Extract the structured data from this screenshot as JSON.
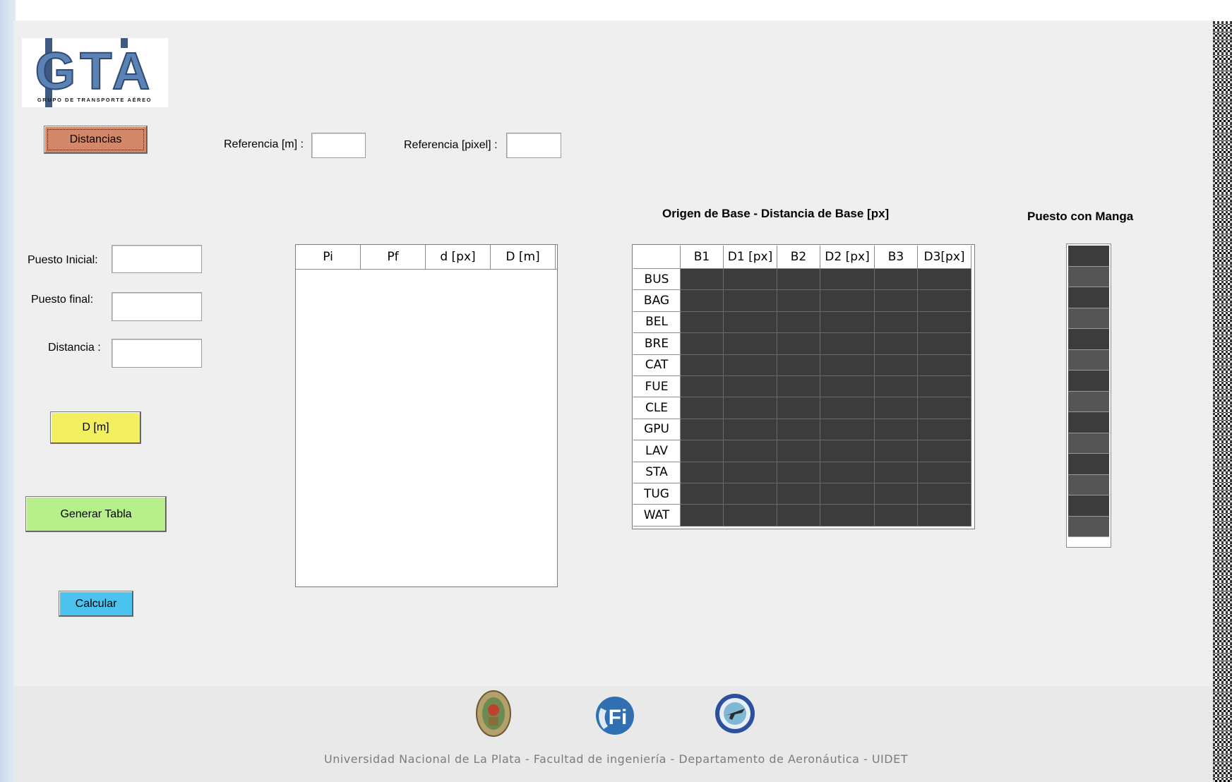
{
  "logo": {
    "text": "GTA",
    "subtitle": "GRUPO DE TRANSPORTE AÉREO"
  },
  "toolbar": {
    "distancias_label": "Distancias",
    "ref_m_label": "Referencia [m] :",
    "ref_m_value": "",
    "ref_px_label": "Referencia [pixel] :",
    "ref_px_value": ""
  },
  "form": {
    "puesto_inicial_label": "Puesto Inicial:",
    "puesto_inicial_value": "",
    "puesto_final_label": "Puesto final:",
    "puesto_final_value": "",
    "distancia_label": "Distancia :",
    "distancia_value": ""
  },
  "buttons": {
    "dm_label": "D [m]",
    "generar_label": "Generar Tabla",
    "calcular_label": "Calcular"
  },
  "distance_table": {
    "columns": [
      "Pi",
      "Pf",
      "d [px]",
      "D [m]"
    ],
    "rows": []
  },
  "base_table": {
    "title": "Origen de Base  - Distancia de Base [px]",
    "columns": [
      "B1",
      "D1 [px]",
      "B2",
      "D2 [px]",
      "B3",
      "D3[px]"
    ],
    "rows": [
      "BUS",
      "BAG",
      "BEL",
      "BRE",
      "CAT",
      "FUE",
      "CLE",
      "GPU",
      "LAV",
      "STA",
      "TUG",
      "WAT"
    ],
    "cell_color": "#3c3c3c"
  },
  "manga": {
    "title": "Puesto con Manga",
    "row_count": 14,
    "colors": [
      "#3c3c3c",
      "#555555"
    ]
  },
  "footer": {
    "icons": [
      "unlp-seal-icon",
      "fi-logo-icon",
      "aeronautica-dept-icon"
    ],
    "text": "Universidad Nacional de La Plata - Facultad de ingeniería - Departamento de Aeronáutica - UIDET"
  }
}
